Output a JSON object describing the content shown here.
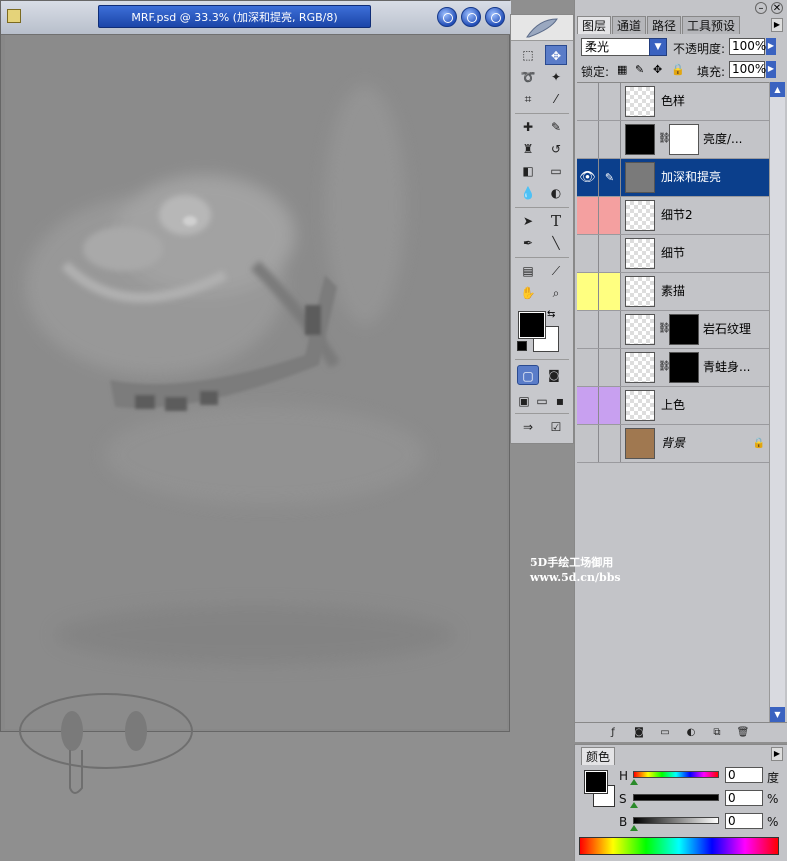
{
  "document": {
    "title": "MRF.psd @ 33.3% (加深和提亮, RGB/8)",
    "window_buttons": [
      "minimize-icon",
      "maximize-icon",
      "close-icon"
    ]
  },
  "toolbox": {
    "tools": [
      "marquee-tool",
      "move-tool",
      "lasso-tool",
      "magic-wand-tool",
      "crop-tool",
      "slice-tool",
      "healing-brush-tool",
      "brush-tool",
      "clone-stamp-tool",
      "history-brush-tool",
      "eraser-tool",
      "gradient-tool",
      "blur-tool",
      "dodge-tool",
      "path-selection-tool",
      "type-tool",
      "pen-tool",
      "line-tool",
      "notes-tool",
      "eyedropper-tool",
      "hand-tool",
      "zoom-tool"
    ],
    "type_glyph": "T",
    "foreground_color": "#000000",
    "background_color": "#ffffff"
  },
  "layers_panel": {
    "tabs": [
      "图层",
      "通道",
      "路径",
      "工具预设"
    ],
    "blend_mode": "柔光",
    "opacity_label": "不透明度:",
    "opacity_value": "100%",
    "lock_label": "锁定:",
    "fill_label": "填充:",
    "fill_value": "100%",
    "layers": [
      {
        "name": "色样",
        "visible": false,
        "color_tag": "none"
      },
      {
        "name": "亮度/...",
        "visible": false,
        "color_tag": "none"
      },
      {
        "name": "加深和提亮",
        "visible": true,
        "color_tag": "none",
        "selected": true
      },
      {
        "name": "细节2",
        "visible": false,
        "color_tag": "#f4a0a0"
      },
      {
        "name": "细节",
        "visible": false,
        "color_tag": "none"
      },
      {
        "name": "素描",
        "visible": false,
        "color_tag": "#ffff80"
      },
      {
        "name": "岩石纹理",
        "visible": false,
        "color_tag": "none"
      },
      {
        "name": "青蛙身...",
        "visible": false,
        "color_tag": "none"
      },
      {
        "name": "上色",
        "visible": false,
        "color_tag": "#c8a0f0"
      },
      {
        "name": "背景",
        "visible": false,
        "color_tag": "none",
        "locked": true
      }
    ]
  },
  "color_panel": {
    "tab": "颜色",
    "sliders": [
      {
        "label": "H",
        "value": "0",
        "unit": "度"
      },
      {
        "label": "S",
        "value": "0",
        "unit": "%"
      },
      {
        "label": "B",
        "value": "0",
        "unit": "%"
      }
    ]
  },
  "watermark": {
    "line1": "5D手绘工场御用",
    "line2": "www.5d.cn/bbs"
  },
  "colors": {
    "selection_blue": "#0b3f8c",
    "title_blue": "#1b45a8",
    "panel_gray": "#c3c4c8"
  }
}
